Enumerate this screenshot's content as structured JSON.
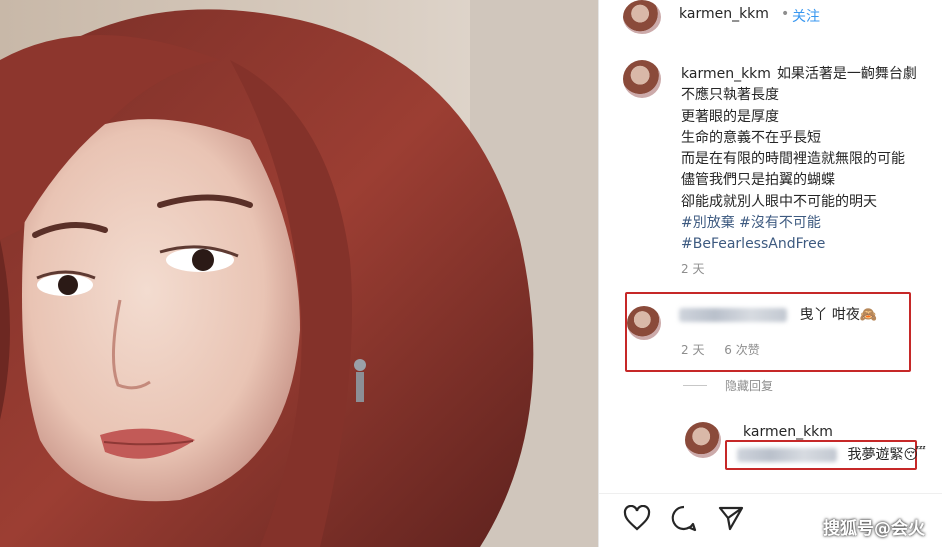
{
  "header": {
    "username": "karmen_kkm",
    "dot": "•",
    "follow_label": "关注"
  },
  "post": {
    "username": "karmen_kkm",
    "caption_lines": [
      "如果活著是一齣舞台劇",
      "不應只執著長度",
      "更著眼的是厚度",
      "生命的意義不在乎長短",
      "而是在有限的時間裡造就無限的可能",
      "儘管我們只是拍翼的蝴蝶",
      "卻能成就別人眼中不可能的明天"
    ],
    "tags": [
      "#別放棄 #沒有不可能",
      "#BeFearlessAndFree"
    ],
    "time": "2 天"
  },
  "comment": {
    "text": "曳丫 咁夜🙈",
    "time": "2 天",
    "likes": "6 次赞"
  },
  "hide_replies_label": "隐藏回复",
  "reply": {
    "username": "karmen_kkm",
    "text": "我夢遊緊😴"
  },
  "actions": [
    "heart-icon",
    "comment-icon",
    "share-icon"
  ],
  "watermark": "搜狐号@会火",
  "colors": {
    "follow": "#3897f0",
    "highlight_box": "#c62828",
    "hashtag": "#3d5a80"
  }
}
